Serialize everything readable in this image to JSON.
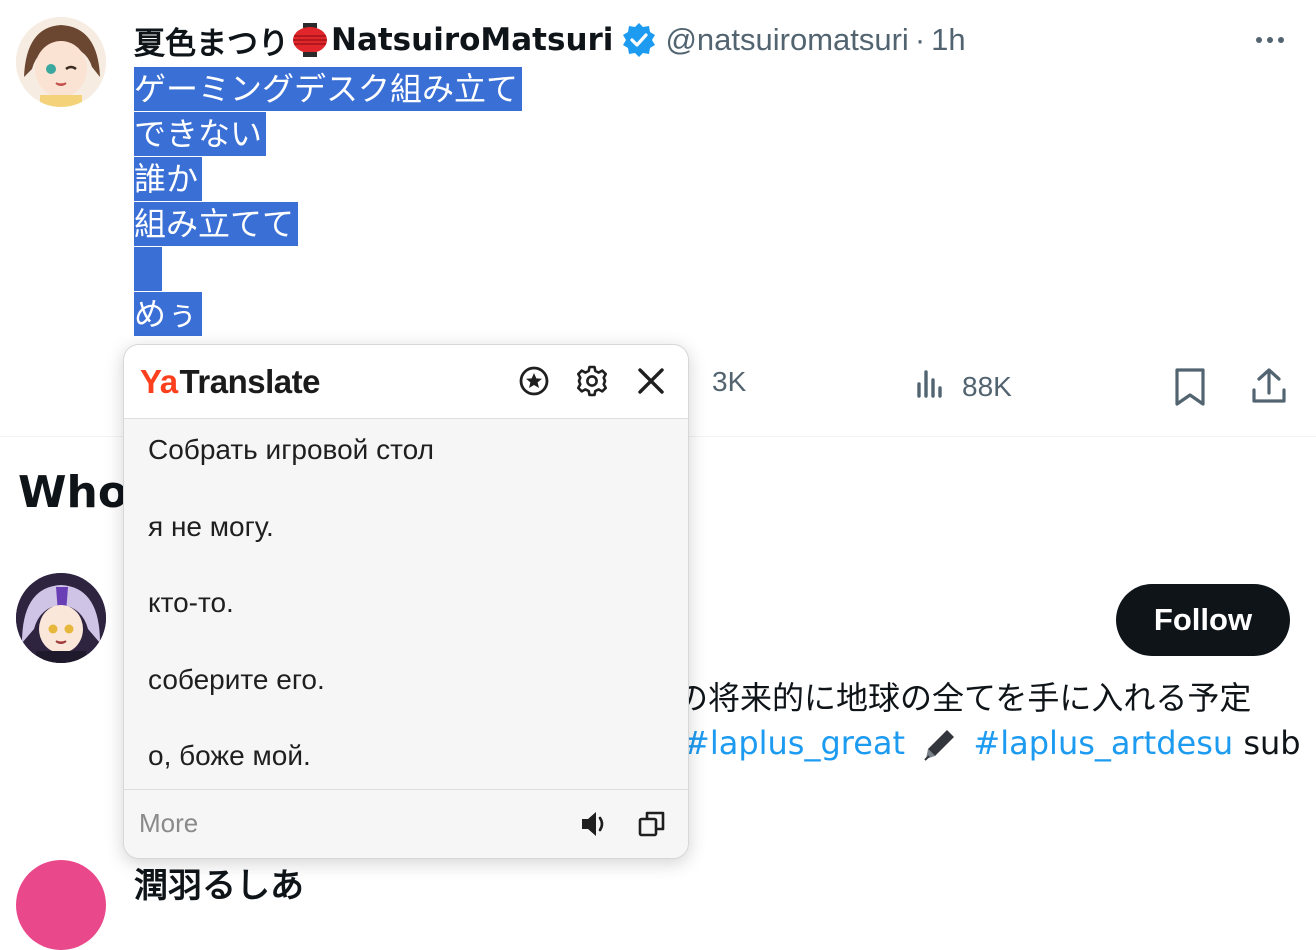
{
  "tweet": {
    "display_name": "夏色まつり",
    "display_name_latin": "NatsuiroMatsuri",
    "handle": "@natsuiromatsuri",
    "separator": "·",
    "time": "1h",
    "lines": [
      "ゲーミングデスク組み立て",
      "できない",
      "誰か",
      "組み立てて",
      "",
      "めぅ"
    ],
    "actions": {
      "likes": "3K",
      "views": "88K"
    }
  },
  "who_to_follow": {
    "title": "Who",
    "follow_label": "Follow",
    "bio_line1": "将来的に地球の全てを手に入れる予定",
    "bio_line2_tags": [
      "#laplus_great",
      "#laplus_artdesu"
    ],
    "bio_line2_tail": "sub",
    "third_name": "潤羽るしあ"
  },
  "translate_popup": {
    "logo_ya": "Ya",
    "logo_word": "Translate",
    "lines": [
      "Собрать игровой стол",
      "я не могу.",
      "кто-то.",
      "соберите его.",
      "о, боже мой."
    ],
    "more_label": "More",
    "icons": [
      "star-icon",
      "gear-icon",
      "close-icon",
      "speaker-icon",
      "copy-icon"
    ]
  },
  "colors": {
    "selection": "#3a6fd6",
    "link": "#1d9bf0",
    "muted": "#536471",
    "yandex_red": "#fc3f1d"
  }
}
